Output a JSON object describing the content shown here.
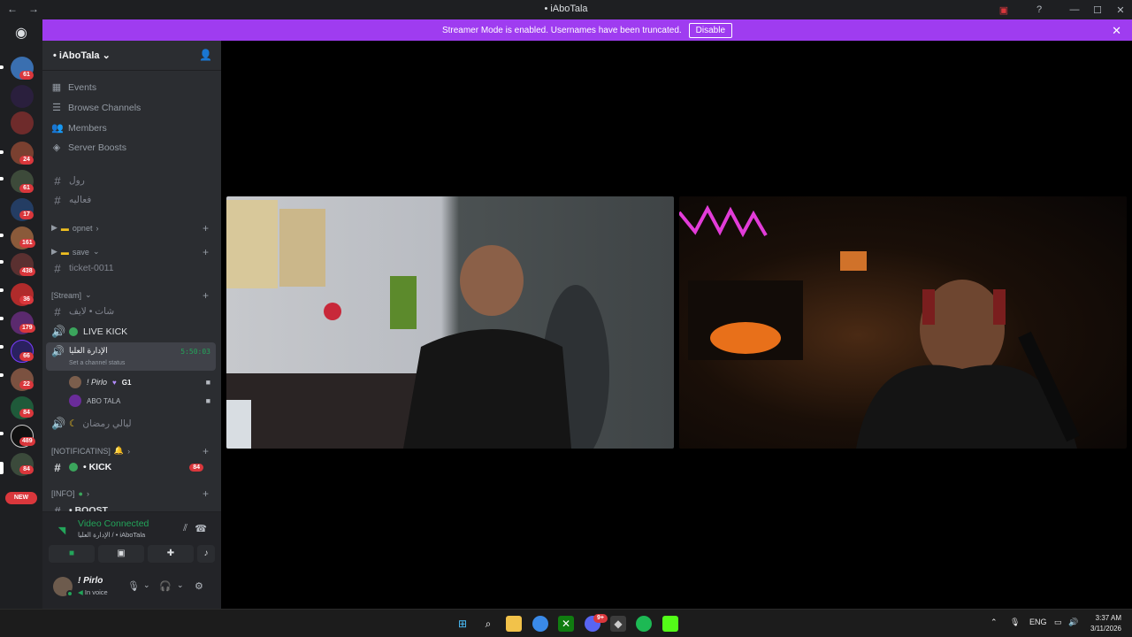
{
  "window": {
    "title": "• iAboTala",
    "back": "←",
    "forward": "→"
  },
  "banner": {
    "message": "Streamer Mode is enabled. Usernames have been truncated.",
    "disable_label": "Disable",
    "close": "✕",
    "color": "#9f3cf0"
  },
  "server_list": {
    "badges": [
      "61",
      "24",
      "61",
      "17",
      "161",
      "438",
      "36",
      "179",
      "66",
      "22",
      "84",
      "489",
      "84"
    ],
    "new_label": "NEW"
  },
  "sidebar": {
    "server_name": "• iAboTala",
    "menu": [
      {
        "label": "Events",
        "icon": "calendar-icon"
      },
      {
        "label": "Browse Channels",
        "icon": "list-icon"
      },
      {
        "label": "Members",
        "icon": "members-icon"
      },
      {
        "label": "Server Boosts",
        "icon": "boost-icon"
      }
    ],
    "channels": {
      "rol": "رول",
      "faaliya": "فعاليه",
      "ticket": "ticket-0011",
      "chat_live": "شات • لايف",
      "live_kick": "LIVE KICK",
      "admin_voice": "الإدارة العليا",
      "admin_voice_status": "Set a channel status",
      "admin_voice_timer": "5:50:03",
      "layali": "ليالي رمضان",
      "kick": "• KICK",
      "kick_badge": "84",
      "boost": "• BOOST"
    },
    "categories": {
      "opnet": "opnet",
      "save": "save",
      "stream": "[Stream]",
      "notifications": "[NOTIFICATINS]",
      "info": "[INFO]"
    },
    "voice_users": [
      {
        "name": "! Pirlo",
        "tag": "G1"
      },
      {
        "name": "ABO TALA",
        "tag": ""
      }
    ]
  },
  "voice_panel": {
    "title": "Video Connected",
    "subtitle": "الإدارة العليا / • iAboTala"
  },
  "user_panel": {
    "name": "! Pirlo",
    "status": "In voice"
  },
  "taskbar": {
    "lang": "ENG",
    "time": "3:37 AM",
    "date": "3/11/2026",
    "discord_badge": "9+"
  }
}
